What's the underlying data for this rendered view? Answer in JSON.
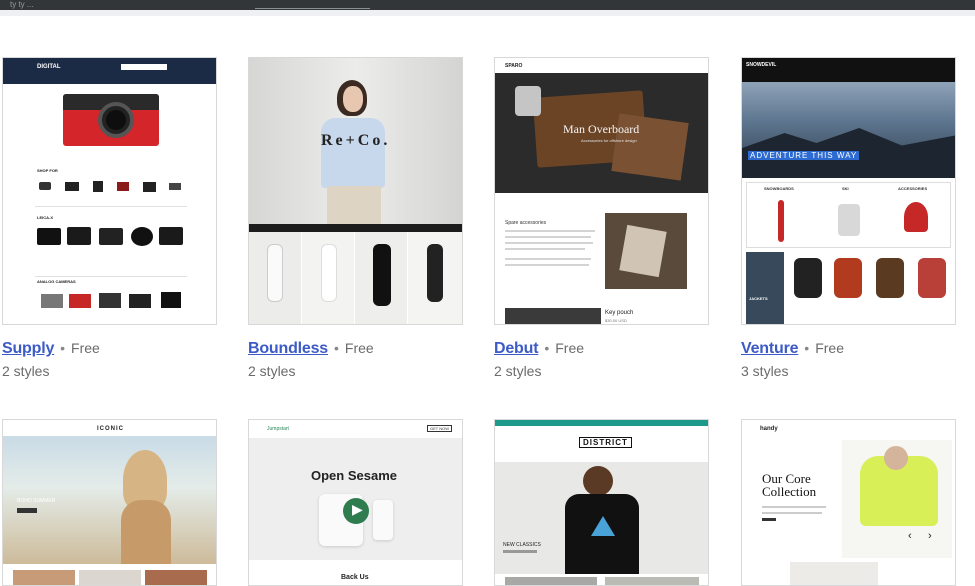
{
  "browser": {
    "tab_text": "ty  ty  ..."
  },
  "themes": [
    {
      "name": "Supply",
      "price": "Free",
      "styles": "2 styles",
      "preview": {
        "logo": "DIGITAL",
        "section1": "SHOP FOR",
        "section2": "LEICA-X",
        "section3": "ANALOG CAMERAS"
      }
    },
    {
      "name": "Boundless",
      "price": "Free",
      "styles": "2 styles",
      "preview": {
        "brand": "Re+Co."
      }
    },
    {
      "name": "Debut",
      "price": "Free",
      "styles": "2 styles",
      "preview": {
        "logo": "SPARO",
        "hero_title": "Man Overboard",
        "hero_sub": "Accessories for offshore design",
        "section": "Spare accessories",
        "product": "Key pouch",
        "product_price": "$30.00 USD"
      }
    },
    {
      "name": "Venture",
      "price": "Free",
      "styles": "3 styles",
      "preview": {
        "logo": "SNOWDEVIL",
        "banner": "ADVENTURE THIS WAY",
        "col1": "SNOWBOARDS",
        "col2": "SKI",
        "col3": "ACCESSORIES",
        "jackets": "JACKETS"
      }
    },
    {
      "name": "",
      "price": "",
      "styles": "",
      "preview": {
        "logo": "ICONIC",
        "tag": "BOHO SUMMER"
      }
    },
    {
      "name": "",
      "price": "",
      "styles": "",
      "preview": {
        "logo": "Jumpstart",
        "headline": "Open Sesame",
        "subhead": "Back Us",
        "cta": "GET NOW"
      }
    },
    {
      "name": "",
      "price": "",
      "styles": "",
      "preview": {
        "logo": "DISTRICT",
        "tag": "NEW CLASSICS"
      }
    },
    {
      "name": "",
      "price": "",
      "styles": "",
      "preview": {
        "logo": "handy",
        "headline": "Our Core Collection"
      }
    }
  ],
  "colors": {
    "link": "#3c5bc6",
    "muted": "#6b6b6b",
    "chrome": "#333638"
  }
}
